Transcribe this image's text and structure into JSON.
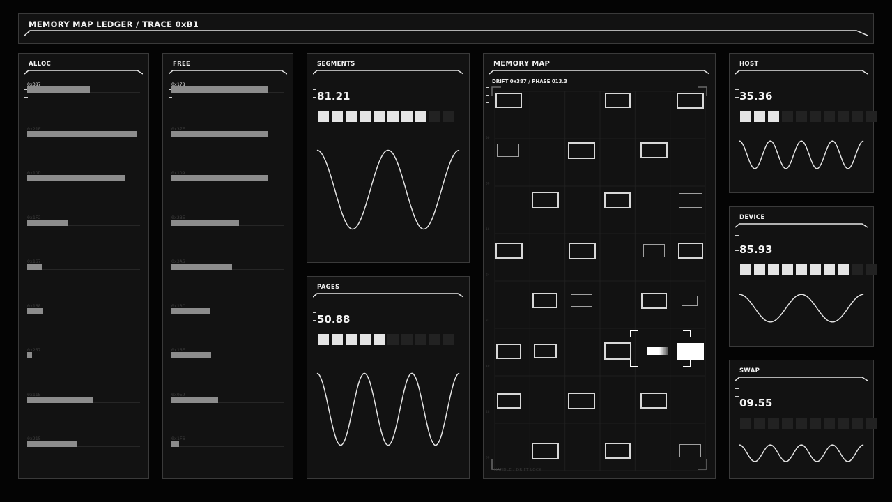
{
  "header": {
    "title": "MEMORY MAP LEDGER / TRACE 0xB1"
  },
  "alloc": {
    "title": "ALLOC",
    "rows": [
      {
        "label": "0x387",
        "value": 0.55
      },
      {
        "label": "0x21F",
        "value": 0.96
      },
      {
        "label": "0x1DD",
        "value": 0.86
      },
      {
        "label": "0x1F2",
        "value": 0.36
      },
      {
        "label": "0x167",
        "value": 0.13
      },
      {
        "label": "0x168",
        "value": 0.14
      },
      {
        "label": "0x257",
        "value": 0.04
      },
      {
        "label": "0x11E",
        "value": 0.58
      },
      {
        "label": "0x215",
        "value": 0.43
      }
    ]
  },
  "free": {
    "title": "FREE",
    "rows": [
      {
        "label": "0x178",
        "value": 0.84
      },
      {
        "label": "0x37F",
        "value": 0.85
      },
      {
        "label": "0x1D9",
        "value": 0.84
      },
      {
        "label": "0x2BE",
        "value": 0.59
      },
      {
        "label": "0x3A6",
        "value": 0.53
      },
      {
        "label": "0x13C",
        "value": 0.34
      },
      {
        "label": "0x16F",
        "value": 0.35
      },
      {
        "label": "0x0E9",
        "value": 0.41
      },
      {
        "label": "0x1F6",
        "value": 0.07
      }
    ]
  },
  "segments": {
    "title": "SEGMENTS",
    "value": "81.21",
    "filled": 8,
    "total": 10,
    "cycles": 2
  },
  "pages": {
    "title": "PAGES",
    "value": "50.88",
    "filled": 5,
    "total": 10,
    "cycles": 3
  },
  "memory_map": {
    "title": "MEMORY MAP",
    "subtitle": "DRIFT 0x387 / PHASE 013.3",
    "footer": "HANDLE / DRIFT LOCK",
    "y_ticks": [
      "00",
      "08",
      "16",
      "24",
      "32",
      "40",
      "48",
      "56",
      "64"
    ]
  },
  "host": {
    "title": "HOST",
    "value": "35.36",
    "filled": 3,
    "total": 10,
    "cycles": 4
  },
  "device": {
    "title": "DEVICE",
    "value": "85.93",
    "filled": 8,
    "total": 10,
    "cycles": 2
  },
  "swap": {
    "title": "SWAP",
    "value": "09.55",
    "filled": 0,
    "total": 10,
    "cycles": 4
  },
  "colors": {
    "accent": "#e4e4e4",
    "bar": "#8c8c8c",
    "panel": "#121212",
    "border": "#3a3a3a"
  }
}
